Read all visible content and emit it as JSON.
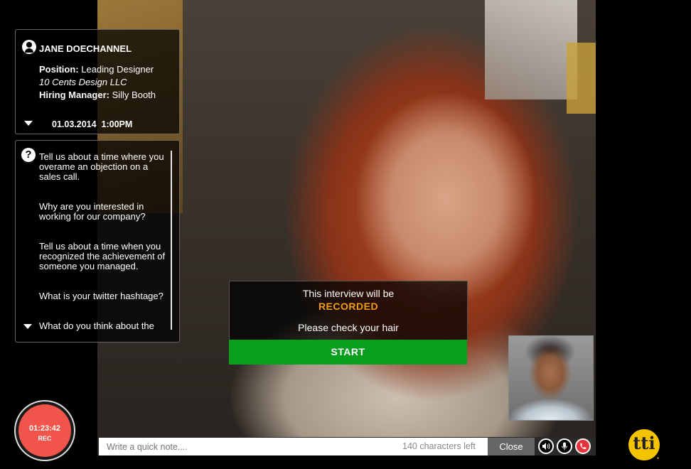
{
  "candidate": {
    "name": "JANE DOECHANNEL",
    "position_label": "Position:",
    "position_value": "Leading Designer",
    "company": "10 Cents Design LLC",
    "manager_label": "Hiring Manager:",
    "manager_value": "Silly Booth",
    "datetime": "01.03.2014  1:00PM"
  },
  "questions": [
    "Tell us about a time where you overame an objection on a sales call.",
    "Why are you interested in working for our company?",
    "Tell us about a time when you recognized the achievement of someone you managed.",
    "What is your twitter hashtage?",
    "What do you think about the"
  ],
  "notice": {
    "line1": "This interview will be",
    "line2": "RECORDED",
    "line3": "Please check your hair",
    "start_label": "START",
    "accent_color": "#f39c12",
    "start_color": "#0a9e1f"
  },
  "recording": {
    "time": "01:23:42",
    "label": "REC",
    "color": "#f0544a"
  },
  "note": {
    "placeholder": "Write a quick note....",
    "chars_left": "140 characters left",
    "close_label": "Close"
  },
  "controls": {
    "speaker_icon": "speaker-icon",
    "mic_icon": "microphone-icon",
    "hangup_icon": "phone-hangup-icon",
    "hangup_color": "#e6323c"
  },
  "brand": {
    "logo_text": "tti",
    "color": "#f5c400"
  }
}
